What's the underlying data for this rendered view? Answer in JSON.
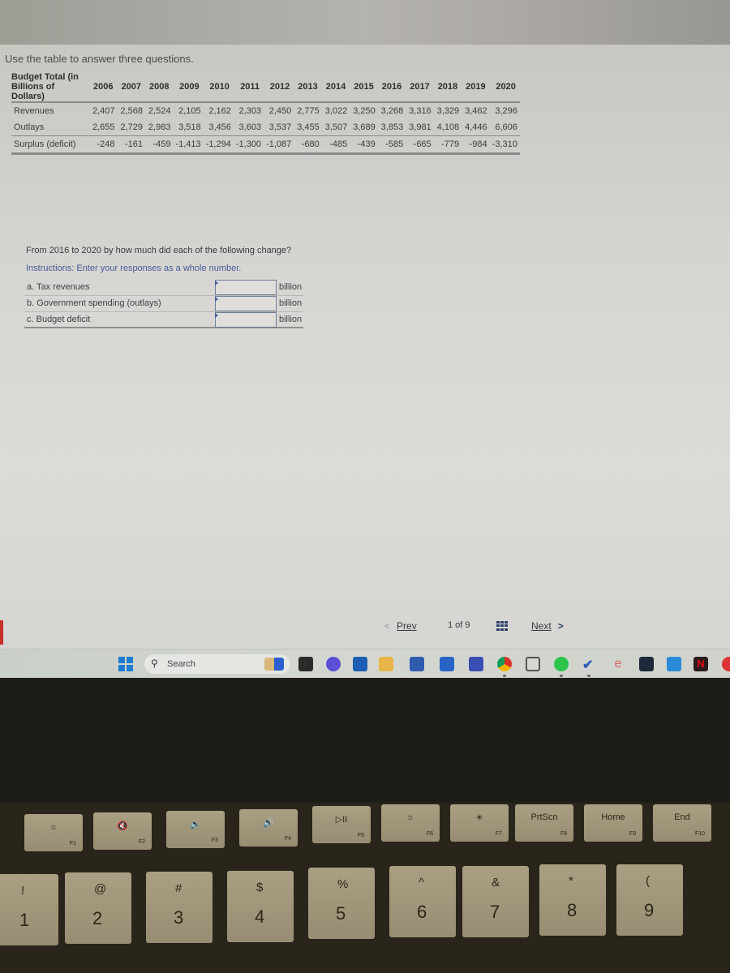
{
  "intro": "Use the table to answer three questions.",
  "table": {
    "corner_header": [
      "Budget Total (in",
      "Billions of",
      "Dollars)"
    ],
    "years": [
      "2006",
      "2007",
      "2008",
      "2009",
      "2010",
      "2011",
      "2012",
      "2013",
      "2014",
      "2015",
      "2016",
      "2017",
      "2018",
      "2019",
      "2020"
    ],
    "rows": [
      {
        "label": "Revenues",
        "values": [
          "2,407",
          "2,568",
          "2,524",
          "2,105",
          "2,162",
          "2,303",
          "2,450",
          "2,775",
          "3,022",
          "3,250",
          "3,268",
          "3,316",
          "3,329",
          "3,462",
          "3,296"
        ]
      },
      {
        "label": "Outlays",
        "values": [
          "2,655",
          "2,729",
          "2,983",
          "3,518",
          "3,456",
          "3,603",
          "3,537",
          "3,455",
          "3,507",
          "3,689",
          "3,853",
          "3,981",
          "4,108",
          "4,446",
          "6,606"
        ]
      },
      {
        "label": "Surplus (deficit)",
        "values": [
          "-248",
          "-161",
          "-459",
          "-1,413",
          "-1,294",
          "-1,300",
          "-1,087",
          "-680",
          "-485",
          "-439",
          "-585",
          "-665",
          "-779",
          "-984",
          "-3,310"
        ]
      }
    ]
  },
  "question": "From 2016 to 2020 by how much did each of the following change?",
  "instructions": "Instructions: Enter your responses as a whole number.",
  "answers": [
    {
      "label": "a. Tax revenues",
      "value": "",
      "unit": "billion"
    },
    {
      "label": "b. Government spending (outlays)",
      "value": "",
      "unit": "billion"
    },
    {
      "label": "c. Budget deficit",
      "value": "",
      "unit": "billion"
    }
  ],
  "pager": {
    "prev_label": "Prev",
    "prev_icon": "<",
    "count": "1 of 9",
    "next_label": "Next",
    "next_icon": ">"
  },
  "taskbar": {
    "search_placeholder": "Search",
    "search_icon": "🔍",
    "apps": [
      "start",
      "task-view",
      "meet",
      "outlook",
      "file-explorer",
      "store",
      "word",
      "app-q",
      "chrome",
      "clock",
      "spotify",
      "todo",
      "edge-e",
      "prime-video",
      "amazon",
      "netflix"
    ]
  },
  "keyboard": {
    "fn_row": [
      {
        "glyph": "☼",
        "fn": "F1"
      },
      {
        "glyph": "🔇",
        "fn": "F2"
      },
      {
        "glyph": "🔈",
        "fn": "F3"
      },
      {
        "glyph": "🔊",
        "fn": "F4"
      },
      {
        "glyph": "▷II",
        "fn": "F5"
      },
      {
        "glyph": "☼",
        "fn": "F6"
      },
      {
        "glyph": "☀",
        "fn": "F7"
      },
      {
        "glyph": "PrtScn",
        "fn": "F8"
      },
      {
        "glyph": "Home",
        "fn": "F9"
      },
      {
        "glyph": "End",
        "fn": "F10"
      }
    ],
    "num_row": [
      {
        "top": "!",
        "main": "1"
      },
      {
        "top": "@",
        "main": "2"
      },
      {
        "top": "#",
        "main": "3"
      },
      {
        "top": "$",
        "main": "4"
      },
      {
        "top": "%",
        "main": "5"
      },
      {
        "top": "^",
        "main": "6"
      },
      {
        "top": "&",
        "main": "7"
      },
      {
        "top": "*",
        "main": "8"
      },
      {
        "top": "(",
        "main": "9"
      }
    ]
  }
}
